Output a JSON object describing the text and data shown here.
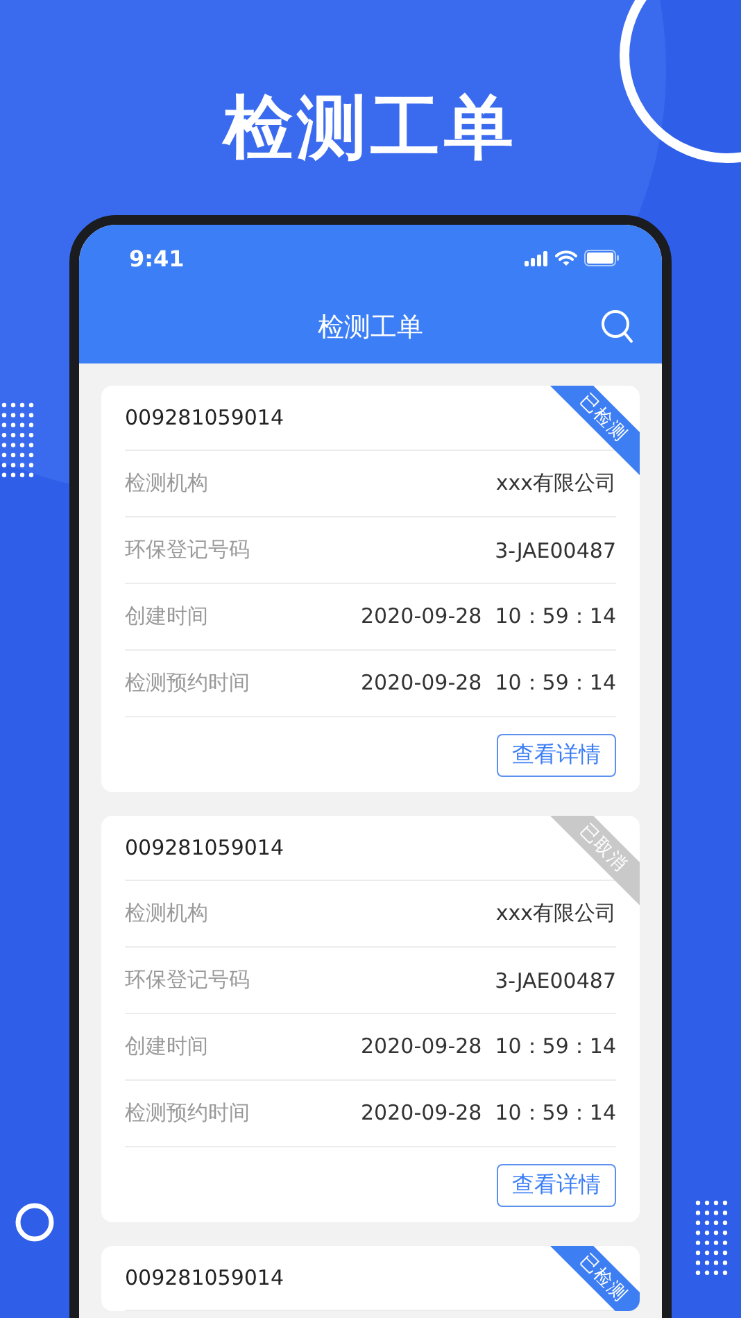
{
  "headline": "检测工单",
  "status_bar": {
    "time": "9:41"
  },
  "nav": {
    "title": "检测工单"
  },
  "orders": [
    {
      "number": "009281059014",
      "status": {
        "text": "已检测",
        "kind": "checked"
      },
      "rows": [
        {
          "label": "检测机构",
          "value": "xxx有限公司"
        },
        {
          "label": "环保登记号码",
          "value": "3-JAE00487"
        },
        {
          "label": "创建时间",
          "value": "2020-09-28  10：59：14"
        },
        {
          "label": "检测预约时间",
          "value": "2020-09-28  10：59：14"
        }
      ],
      "button": "查看详情"
    },
    {
      "number": "009281059014",
      "status": {
        "text": "已取消",
        "kind": "cancelled"
      },
      "rows": [
        {
          "label": "检测机构",
          "value": "xxx有限公司"
        },
        {
          "label": "环保登记号码",
          "value": "3-JAE00487"
        },
        {
          "label": "创建时间",
          "value": "2020-09-28  10：59：14"
        },
        {
          "label": "检测预约时间",
          "value": "2020-09-28  10：59：14"
        }
      ],
      "button": "查看详情"
    },
    {
      "number": "009281059014",
      "status": {
        "text": "已检测",
        "kind": "checked"
      }
    }
  ]
}
